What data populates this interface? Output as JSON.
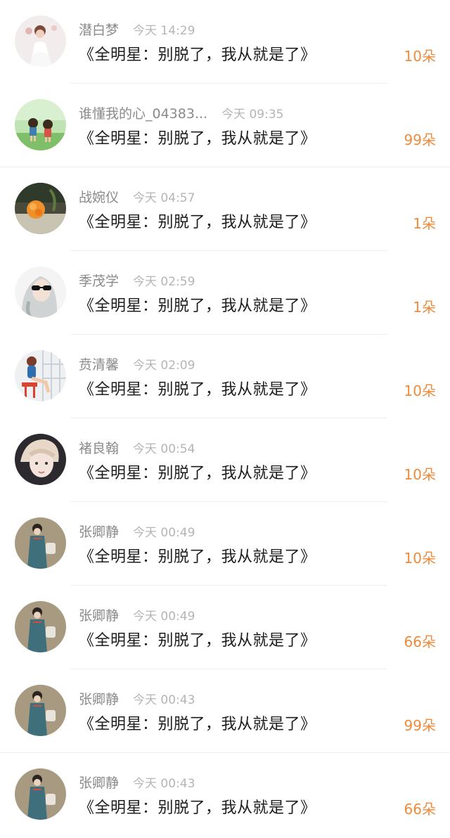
{
  "gifts": [
    {
      "user": "潜白梦",
      "time": "今天 14:29",
      "title": "《全明星：别脱了，我从就是了》",
      "flowers": "10朵",
      "avatar_icon": "girl-white-dress-avatar"
    },
    {
      "user": "谁懂我的心_04383...",
      "time": "今天 09:35",
      "title": "《全明星：别脱了，我从就是了》",
      "flowers": "99朵",
      "avatar_icon": "cartoon-kids-avatar"
    },
    {
      "user": "战婉仪",
      "time": "今天 04:57",
      "title": "《全明星：别脱了，我从就是了》",
      "flowers": "1朵",
      "avatar_icon": "orange-flower-avatar"
    },
    {
      "user": "季茂学",
      "time": "今天 02:59",
      "title": "《全明星：别脱了，我从就是了》",
      "flowers": "1朵",
      "avatar_icon": "sunglasses-girl-avatar"
    },
    {
      "user": "贲清馨",
      "time": "今天 02:09",
      "title": "《全明星：别脱了，我从就是了》",
      "flowers": "10朵",
      "avatar_icon": "pinup-girl-avatar"
    },
    {
      "user": "褚良翰",
      "time": "今天 00:54",
      "title": "《全明星：别脱了，我从就是了》",
      "flowers": "10朵",
      "avatar_icon": "portrait-boy-avatar"
    },
    {
      "user": "张卿静",
      "time": "今天 00:49",
      "title": "《全明星：别脱了，我从就是了》",
      "flowers": "10朵",
      "avatar_icon": "qipao-girl-avatar"
    },
    {
      "user": "张卿静",
      "time": "今天 00:49",
      "title": "《全明星：别脱了，我从就是了》",
      "flowers": "66朵",
      "avatar_icon": "qipao-girl-avatar"
    },
    {
      "user": "张卿静",
      "time": "今天 00:43",
      "title": "《全明星：别脱了，我从就是了》",
      "flowers": "99朵",
      "avatar_icon": "qipao-girl-avatar"
    },
    {
      "user": "张卿静",
      "time": "今天 00:43",
      "title": "《全明星：别脱了，我从就是了》",
      "flowers": "66朵",
      "avatar_icon": "qipao-girl-avatar"
    }
  ],
  "colors": {
    "flower_count": "#f08a3a",
    "username": "#8a8a8a",
    "timestamp": "#b5b5b5",
    "title": "#1d1d1d",
    "divider": "#eeeeee"
  }
}
